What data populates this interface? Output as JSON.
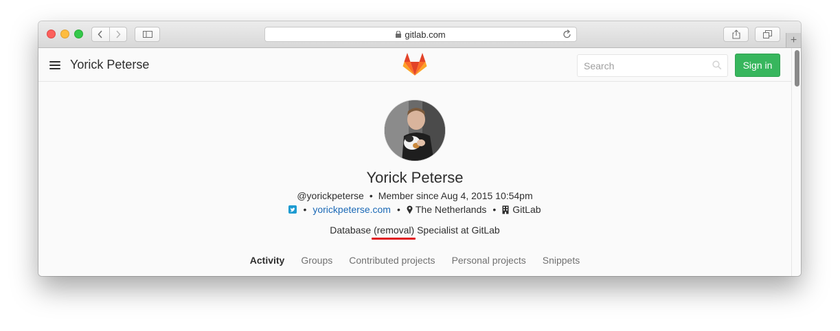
{
  "browser": {
    "url": "gitlab.com",
    "new_tab_label": "+"
  },
  "header": {
    "site_title": "Yorick Peterse",
    "search_placeholder": "Search",
    "sign_in_label": "Sign in"
  },
  "profile": {
    "name": "Yorick Peterse",
    "username": "@yorickpeterse",
    "member_since": "Member since Aug 4, 2015 10:54pm",
    "website": "yorickpeterse.com",
    "location": "The Netherlands",
    "organization": "GitLab",
    "bio": "Database (removal) Specialist at GitLab"
  },
  "tabs": [
    "Activity",
    "Groups",
    "Contributed projects",
    "Personal projects",
    "Snippets"
  ],
  "active_tab": "Activity",
  "colors": {
    "sign_in_button": "#37b65d",
    "link": "#1b69b6",
    "annotation_underline": "#e0161e"
  },
  "icons": {
    "twitter": "twitter-icon",
    "location": "map-marker-icon",
    "organization": "building-icon"
  }
}
